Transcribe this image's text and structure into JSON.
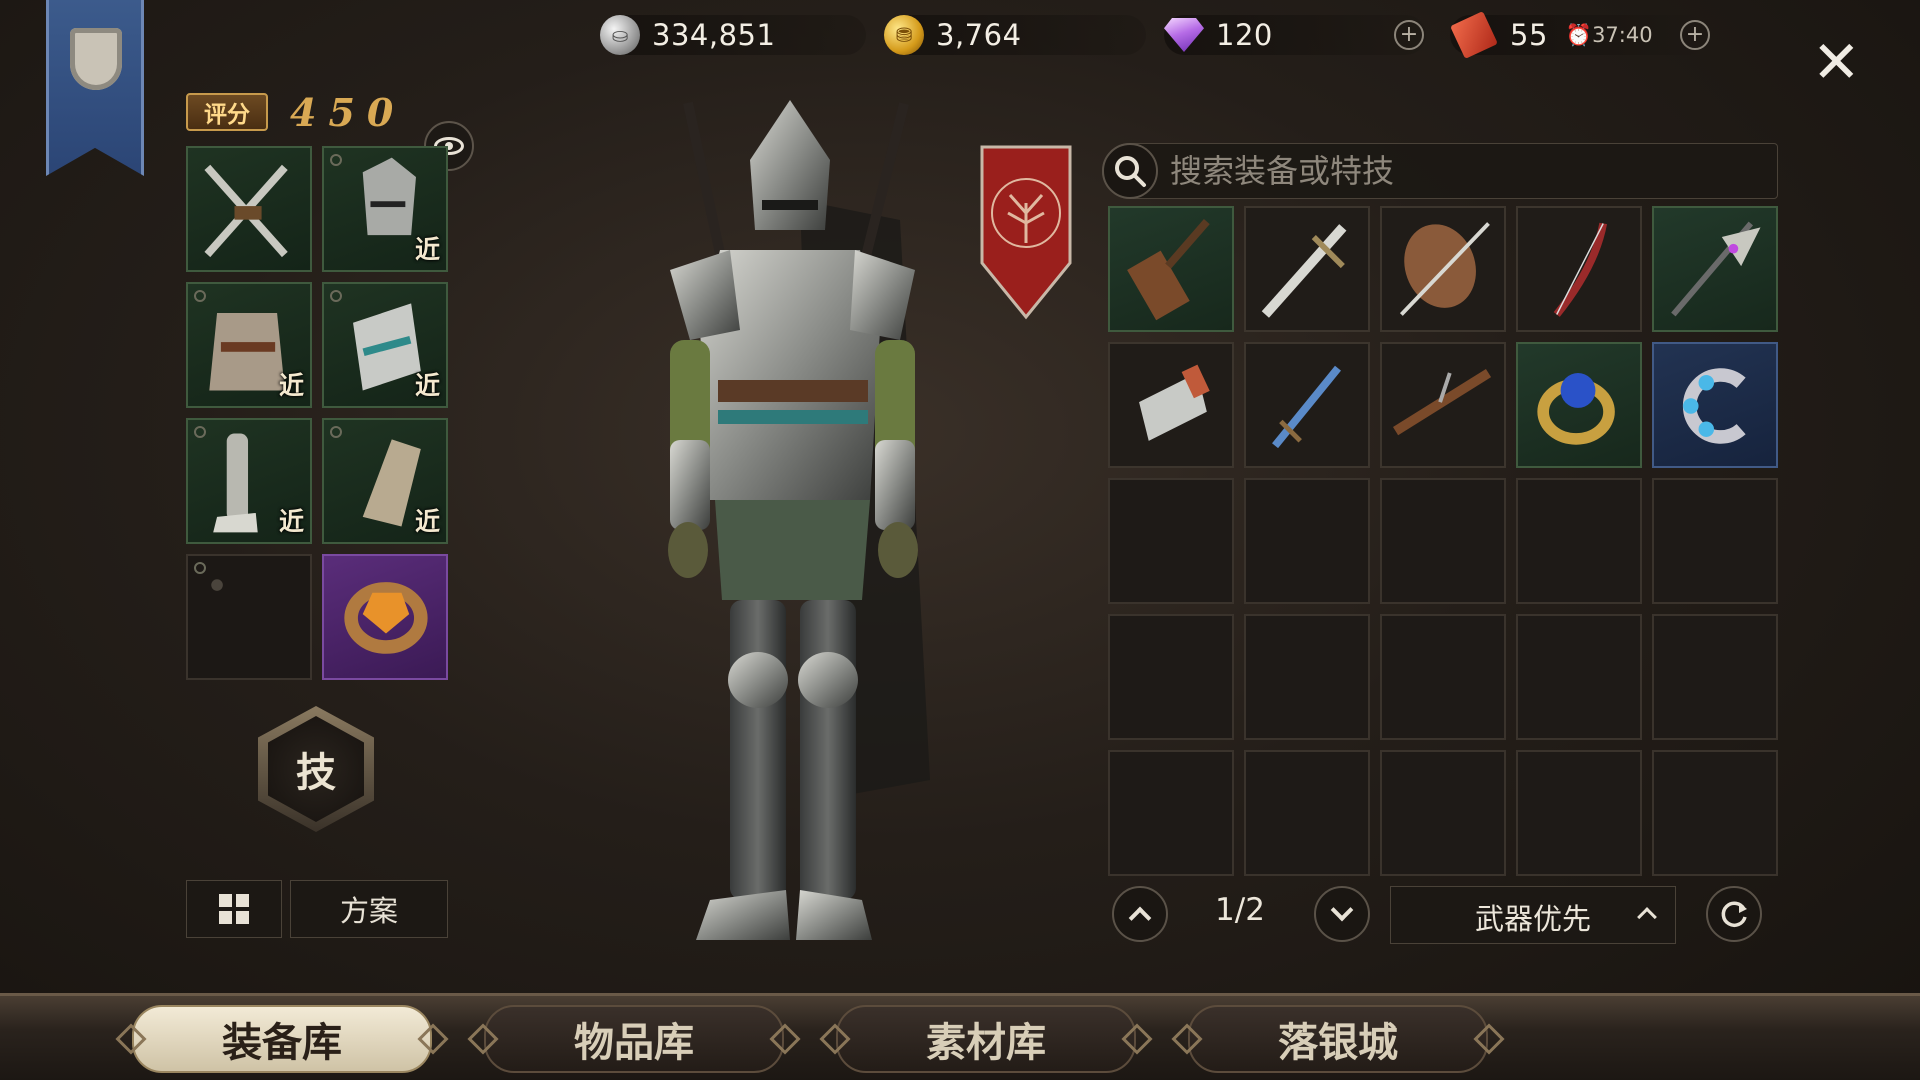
{
  "currencies": {
    "silver": {
      "value": "334,851",
      "icon": "silver-coin-icon"
    },
    "gold": {
      "value": "3,764",
      "icon": "gold-coin-icon"
    },
    "gem": {
      "value": "120",
      "icon": "purple-gem-icon"
    },
    "ticket": {
      "value": "55",
      "timer": "37:40",
      "icon": "red-ticket-icon"
    }
  },
  "close_glyph": "✕",
  "score": {
    "label": "评分",
    "value": "450"
  },
  "equipped": [
    {
      "name": "crossed-swords",
      "near": "",
      "variant": "green"
    },
    {
      "name": "knight-helmet",
      "near": "近",
      "variant": "green"
    },
    {
      "name": "chest-armor",
      "near": "近",
      "variant": "green"
    },
    {
      "name": "arm-bracer",
      "near": "近",
      "variant": "green"
    },
    {
      "name": "leg-greaves",
      "near": "近",
      "variant": "green"
    },
    {
      "name": "gauntlet",
      "near": "近",
      "variant": "green"
    },
    {
      "name": "empty-slot",
      "near": "",
      "variant": "empty"
    },
    {
      "name": "amber-ring",
      "near": "",
      "variant": "purple"
    }
  ],
  "skill_label": "技",
  "plan_label": "方案",
  "search": {
    "placeholder": "搜索装备或特技"
  },
  "inventory": [
    {
      "name": "hammer-weapon",
      "variant": "green"
    },
    {
      "name": "longsword",
      "variant": "dark"
    },
    {
      "name": "shield-and-spear",
      "variant": "dark"
    },
    {
      "name": "recurve-bow",
      "variant": "dark"
    },
    {
      "name": "halberd",
      "variant": "green"
    },
    {
      "name": "steel-bracer",
      "variant": "dark"
    },
    {
      "name": "short-sword",
      "variant": "dark"
    },
    {
      "name": "crossbow",
      "variant": "dark"
    },
    {
      "name": "sapphire-ring",
      "variant": "green"
    },
    {
      "name": "blue-gem-bracelet",
      "variant": "blue"
    }
  ],
  "pagination": {
    "text": "1/2"
  },
  "sort": {
    "label": "武器优先"
  },
  "tabs": [
    {
      "label": "装备库",
      "active": true
    },
    {
      "label": "物品库",
      "active": false
    },
    {
      "label": "素材库",
      "active": false
    },
    {
      "label": "落银城",
      "active": false
    }
  ],
  "colors": {
    "accent_gold": "#d9a954",
    "panel_green": "#1f3322",
    "panel_purple": "#5a2d7a",
    "panel_blue": "#223352"
  }
}
